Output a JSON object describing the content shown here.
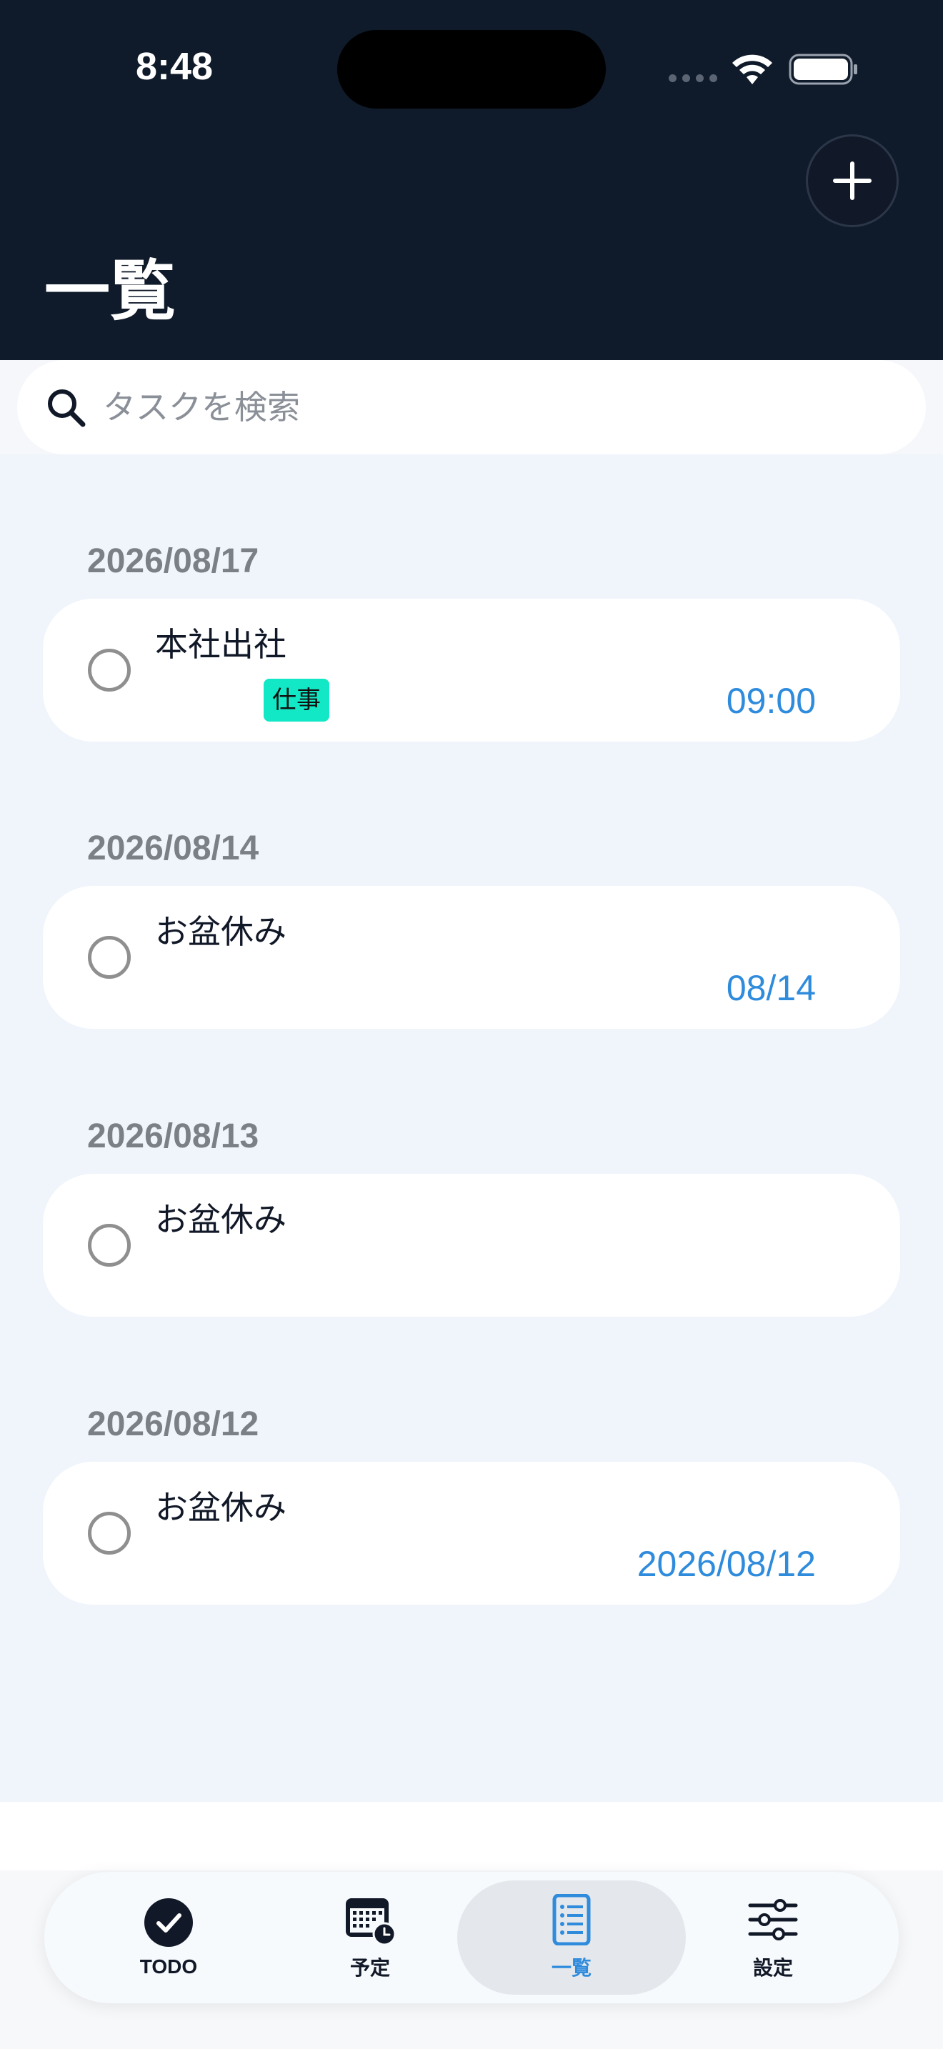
{
  "status_bar": {
    "time": "8:48"
  },
  "header": {
    "title": "一覧",
    "add_icon": "plus-icon"
  },
  "search": {
    "placeholder": "タスクを検索",
    "value": ""
  },
  "groups": [
    {
      "date": "2026/08/17",
      "task": {
        "title": "本社出社",
        "tag": "仕事",
        "time": "09:00"
      }
    },
    {
      "date": "2026/08/14",
      "task": {
        "title": "お盆休み",
        "time": "08/14"
      }
    },
    {
      "date": "2026/08/13",
      "task": {
        "title": "お盆休み"
      }
    },
    {
      "date": "2026/08/12",
      "task": {
        "title": "お盆休み",
        "time": "2026/08/12"
      }
    }
  ],
  "tabs": [
    {
      "label": "TODO",
      "icon": "check-circle-icon"
    },
    {
      "label": "予定",
      "icon": "calendar-clock-icon"
    },
    {
      "label": "一覧",
      "icon": "list-icon"
    },
    {
      "label": "設定",
      "icon": "sliders-icon"
    }
  ],
  "active_tab": "一覧",
  "colors": {
    "header_bg": "#0f1a2a",
    "accent": "#2f8bdc",
    "tag_bg": "#12e8c5",
    "list_bg": "#f0f5fc"
  }
}
